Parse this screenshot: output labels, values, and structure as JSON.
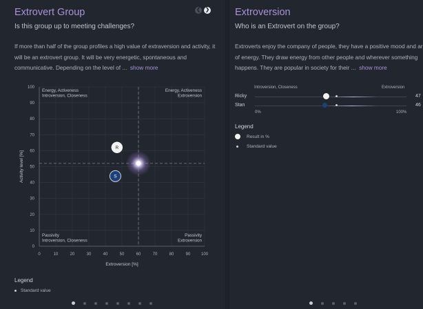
{
  "left": {
    "title": "Extrovert Group",
    "subtitle": "Is this group up to meeting challenges?",
    "para_line1": "If more than half of the group profiles a high value of extraversion and activity, it",
    "para_line2": "will be an extrovert group. It will be very energetic, spontaneous and",
    "para_line3": "communicative. Depending on the level of ...",
    "show_more": "show more",
    "legend_title": "Legend",
    "legend_standard": "Standard value",
    "dots_count": 8,
    "dots_active": 0
  },
  "right": {
    "title": "Extroversion",
    "subtitle": "Who is an Extrovert on the group?",
    "para_line1": "Extroverts enjoy the company of people, they have a positive mood and are fu",
    "para_line2": "of energy. They draw energy from other people and wherever something",
    "para_line3": "happens. They are popular in society for their ...",
    "show_more": "show more",
    "scale_left": "Introversion, Closeness",
    "scale_right": "Extroversion",
    "pct_min": "0%",
    "pct_max": "100%",
    "people": [
      {
        "name": "Ricky",
        "value": 47,
        "value_label": "47"
      },
      {
        "name": "Stan",
        "value": 46,
        "value_label": "46"
      }
    ],
    "standard_value_pct": 54,
    "legend_title": "Legend",
    "legend_result": "Result in %",
    "legend_standard": "Standard value",
    "dots_count": 5,
    "dots_active": 0
  },
  "chart_data": {
    "type": "scatter",
    "xlabel": "Extroversion [%]",
    "ylabel": "Activity level [%]",
    "xlim": [
      0,
      100
    ],
    "ylim": [
      0,
      100
    ],
    "xticks": [
      0,
      10,
      20,
      30,
      40,
      50,
      60,
      70,
      80,
      90,
      100
    ],
    "yticks": [
      0,
      10,
      20,
      30,
      40,
      50,
      60,
      70,
      80,
      90,
      100
    ],
    "reference": {
      "x": 60,
      "y": 52
    },
    "quadrants": {
      "top_left": [
        "Energy, Activeness",
        "Introversion, Closeness"
      ],
      "top_right": [
        "Energy, Activeness",
        "Extroversion"
      ],
      "bottom_left": [
        "Passivity",
        "Introversion, Closeness"
      ],
      "bottom_right": [
        "Passivity",
        "Extroversion"
      ]
    },
    "points": [
      {
        "label": "R",
        "x": 47,
        "y": 62,
        "color": "#f2f2f2"
      },
      {
        "label": "S",
        "x": 46,
        "y": 44,
        "color": "#1f3f7a"
      }
    ],
    "grid": true
  },
  "colors": {
    "accent": "#a994d6",
    "panel": "#22262e",
    "background": "#1d2128",
    "stan_blue": "#1f3f7a"
  }
}
